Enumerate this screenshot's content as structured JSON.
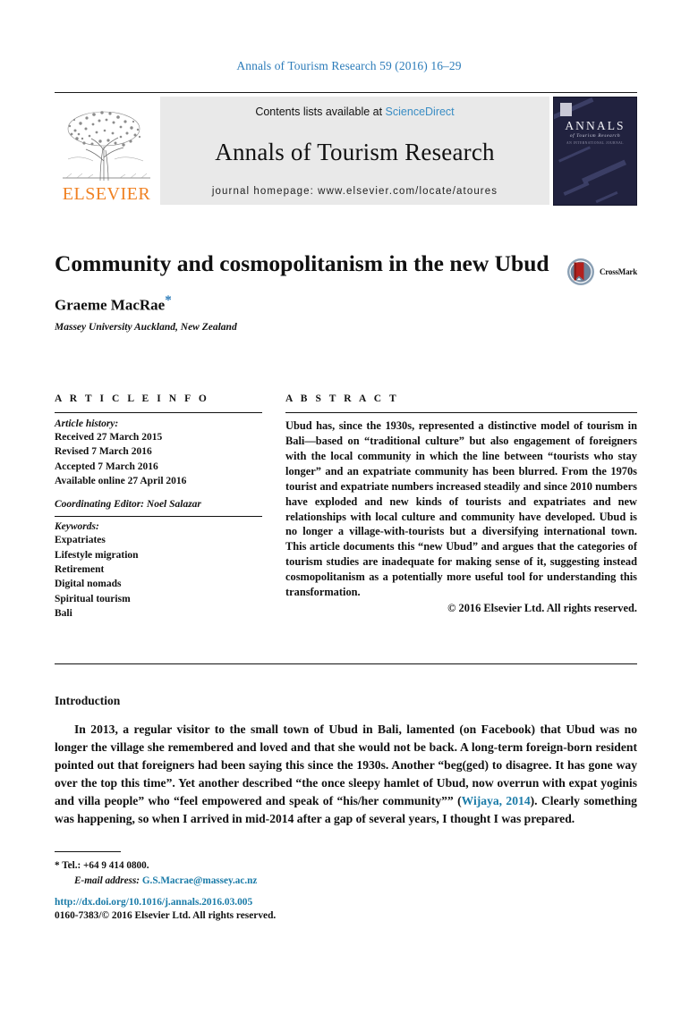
{
  "running_head": "Annals of Tourism Research 59 (2016) 16–29",
  "masthead": {
    "publisher_logo_text": "ELSEVIER",
    "contents_prefix": "Contents lists available at ",
    "contents_link": "ScienceDirect",
    "journal_name": "Annals of Tourism Research",
    "homepage": "journal homepage: www.elsevier.com/locate/atoures",
    "cover": {
      "title": "ANNALS",
      "subtitle": "of Tourism Research",
      "subtitle2": "AN INTERNATIONAL JOURNAL"
    }
  },
  "title_block": {
    "title": "Community and cosmopolitanism in the new Ubud",
    "author": "Graeme MacRae",
    "author_marker": "*",
    "affiliation": "Massey University Auckland, New Zealand",
    "crossmark_label": "CrossMark"
  },
  "article_info": {
    "section_label": "A R T I C L E   I N F O",
    "history_heading": "Article history:",
    "history": [
      "Received 27 March 2015",
      "Revised 7 March 2016",
      "Accepted 7 March 2016",
      "Available online 27 April 2016"
    ],
    "coordinating_editor": "Coordinating Editor: Noel Salazar",
    "keywords_heading": "Keywords:",
    "keywords": [
      "Expatriates",
      "Lifestyle migration",
      "Retirement",
      "Digital nomads",
      "Spiritual tourism",
      "Bali"
    ]
  },
  "abstract": {
    "section_label": "A B S T R A C T",
    "text": "Ubud has, since the 1930s, represented a distinctive model of tourism in Bali—based on “traditional culture” but also engagement of foreigners with the local community in which the line between “tourists who stay longer” and an expatriate community has been blurred. From the 1970s tourist and expatriate numbers increased steadily and since 2010 numbers have exploded and new kinds of tourists and expatriates and new relationships with local culture and community have developed. Ubud is no longer a village-with-tourists but a diversifying international town. This article documents this “new Ubud” and argues that the categories of tourism studies are inadequate for making sense of it, suggesting instead cosmopolitanism as a potentially more useful tool for understanding this transformation.",
    "copyright": "© 2016 Elsevier Ltd. All rights reserved."
  },
  "body": {
    "heading": "Introduction",
    "paragraph_part1": "In 2013, a regular visitor to the small town of Ubud in Bali, lamented (on Facebook) that Ubud was no longer the village she remembered and loved and that she would not be back. A long-term foreign-born resident pointed out that foreigners had been saying this since the 1930s. Another “beg(ged) to disagree. It has gone way over the top this time”. Yet another described “the once sleepy hamlet of Ubud, now overrun with expat yoginis and villa people” who “feel empowered and speak of “his/her community”” (",
    "citation": "Wijaya, 2014",
    "paragraph_part2": "). Clearly something was happening, so when I arrived in mid-2014 after a gap of several years, I thought I was prepared."
  },
  "footnotes": {
    "tel_marker": "*",
    "tel": "Tel.: +64 9 414 0800.",
    "email_label": "E-mail address:",
    "email": "G.S.Macrae@massey.ac.nz"
  },
  "footer": {
    "doi": "http://dx.doi.org/10.1016/j.annals.2016.03.005",
    "issn_line": "0160-7383/© 2016 Elsevier Ltd. All rights reserved."
  },
  "colors": {
    "link_blue": "#2b7bb9",
    "elsevier_orange": "#f08122",
    "cover_navy": "#21223f",
    "crossmark_red": "#b3211e"
  }
}
